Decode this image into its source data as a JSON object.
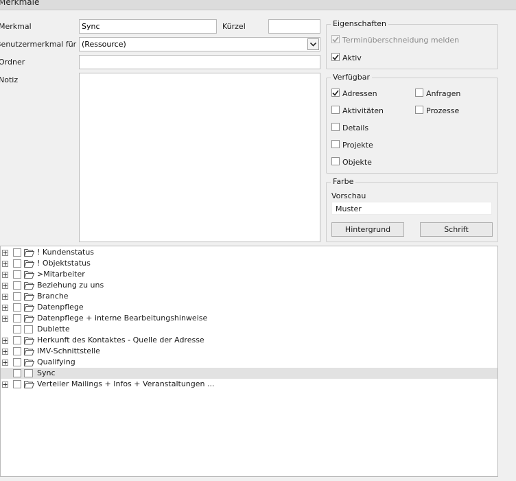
{
  "window": {
    "title": "Merkmale"
  },
  "form": {
    "merkmal_label": "Merkmal",
    "merkmal_value": "Sync",
    "kuerzel_label": "Kürzel",
    "kuerzel_value": "",
    "benutzermerkmal_label": "Benutzermerkmal für",
    "benutzermerkmal_value": "(Ressource)",
    "ordner_label": "Ordner",
    "ordner_value": "",
    "notiz_label": "Notiz",
    "notiz_value": ""
  },
  "eigenschaften": {
    "title": "Eigenschaften",
    "termin_label": "Terminüberschneidung melden",
    "termin_checked": true,
    "termin_enabled": false,
    "aktiv_label": "Aktiv",
    "aktiv_checked": true
  },
  "verfuegbar": {
    "title": "Verfügbar",
    "adressen": "Adressen",
    "anfragen": "Anfragen",
    "aktivitaeten": "Aktivitäten",
    "prozesse": "Prozesse",
    "details": "Details",
    "projekte": "Projekte",
    "objekte": "Objekte",
    "checked": [
      "adressen"
    ]
  },
  "farbe": {
    "title": "Farbe",
    "vorschau_label": "Vorschau",
    "muster_text": "Muster",
    "hintergrund_button": "Hintergrund",
    "schrift_button": "Schrift"
  },
  "tree": {
    "items": [
      {
        "label": "! Kundenstatus",
        "expandable": true,
        "folder": true,
        "selected": false
      },
      {
        "label": "! Objektstatus",
        "expandable": true,
        "folder": true,
        "selected": false
      },
      {
        "label": ">Mitarbeiter",
        "expandable": true,
        "folder": true,
        "selected": false
      },
      {
        "label": "Beziehung zu uns",
        "expandable": true,
        "folder": true,
        "selected": false
      },
      {
        "label": "Branche",
        "expandable": true,
        "folder": true,
        "selected": false
      },
      {
        "label": "Datenpflege",
        "expandable": true,
        "folder": true,
        "selected": false
      },
      {
        "label": "Datenpflege + interne Bearbeitungshinweise",
        "expandable": true,
        "folder": true,
        "selected": false
      },
      {
        "label": "Dublette",
        "expandable": false,
        "folder": false,
        "selected": false
      },
      {
        "label": "Herkunft des Kontaktes - Quelle der Adresse",
        "expandable": true,
        "folder": true,
        "selected": false
      },
      {
        "label": "IMV-Schnittstelle",
        "expandable": true,
        "folder": true,
        "selected": false
      },
      {
        "label": "Qualifying",
        "expandable": true,
        "folder": true,
        "selected": false
      },
      {
        "label": "Sync",
        "expandable": false,
        "folder": false,
        "selected": true
      },
      {
        "label": "Verteiler Mailings + Infos + Veranstaltungen ...",
        "expandable": true,
        "folder": true,
        "selected": false
      }
    ]
  }
}
